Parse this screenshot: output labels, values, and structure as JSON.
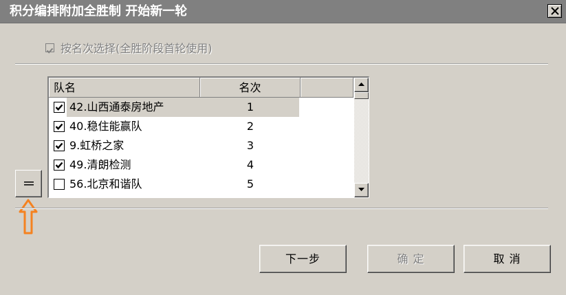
{
  "window": {
    "title": "积分编排附加全胜制  开始新一轮",
    "close_icon": "close-icon"
  },
  "option": {
    "label": "按名次选择(全胜阶段首轮使用)",
    "checked": true,
    "enabled": false
  },
  "list": {
    "columns": [
      "队名",
      "名次",
      ""
    ],
    "rows": [
      {
        "checked": true,
        "name": "42.山西通泰房地产",
        "rank": "1",
        "selected": true
      },
      {
        "checked": true,
        "name": "40.稳住能赢队",
        "rank": "2",
        "selected": false
      },
      {
        "checked": true,
        "name": "9.虹桥之家",
        "rank": "3",
        "selected": false
      },
      {
        "checked": true,
        "name": "49.清朗检测",
        "rank": "4",
        "selected": false
      },
      {
        "checked": false,
        "name": "56.北京和谐队",
        "rank": "5",
        "selected": false
      }
    ]
  },
  "side_button": {
    "icon": "menu-icon"
  },
  "annotation": {
    "icon": "arrow-up-icon",
    "color": "#f58220"
  },
  "buttons": {
    "next": "下一步",
    "ok": "确 定",
    "cancel": "取 消"
  }
}
